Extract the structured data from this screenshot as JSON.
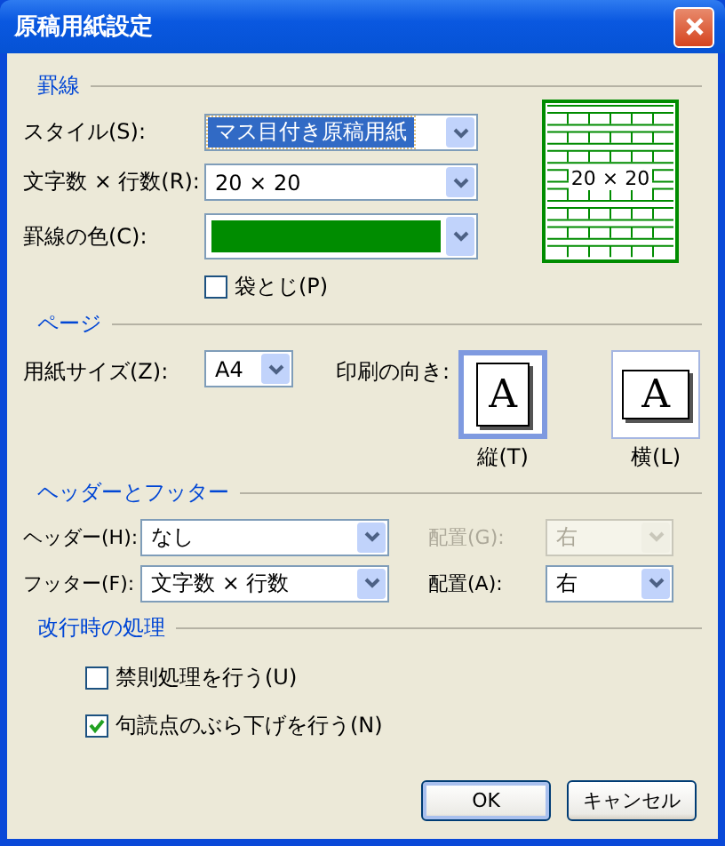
{
  "window": {
    "title": "原稿用紙設定"
  },
  "ruled_lines": {
    "heading": "罫線",
    "style": {
      "label": "スタイル(S):",
      "value": "マス目付き原稿用紙"
    },
    "chars_lines": {
      "label": "文字数 × 行数(R):",
      "value": "20 × 20"
    },
    "line_color": {
      "label": "罫線の色(C):",
      "color": "#008c00"
    },
    "bound": {
      "label": "袋とじ(P)",
      "checked": false
    },
    "preview": {
      "label": "20 × 20"
    }
  },
  "page": {
    "heading": "ページ",
    "paper_size": {
      "label": "用紙サイズ(Z):",
      "value": "A4"
    },
    "orientation_label": "印刷の向き:",
    "orientations": [
      {
        "label": "縦(T)",
        "glyph": "A",
        "kind": "portrait",
        "selected": true
      },
      {
        "label": "横(L)",
        "glyph": "A",
        "kind": "landscape",
        "selected": false
      }
    ]
  },
  "header_footer": {
    "heading": "ヘッダーとフッター",
    "rows": [
      {
        "label": "ヘッダー(H):",
        "value": "なし",
        "align_label": "配置(G):",
        "align_value": "右",
        "align_disabled": true
      },
      {
        "label": "フッター(F):",
        "value": "文字数 × 行数",
        "align_label": "配置(A):",
        "align_value": "右",
        "align_disabled": false
      }
    ]
  },
  "line_break": {
    "heading": "改行時の処理",
    "options": [
      {
        "label": "禁則処理を行う(U)",
        "checked": false
      },
      {
        "label": "句読点のぶら下げを行う(N)",
        "checked": true
      }
    ]
  },
  "buttons": [
    "OK",
    "キャンセル"
  ]
}
